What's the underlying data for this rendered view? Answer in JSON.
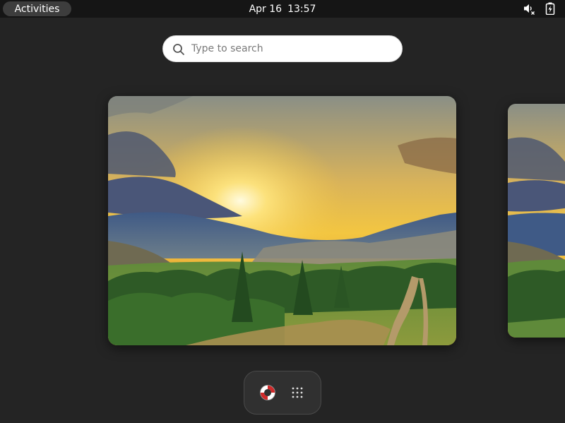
{
  "topbar": {
    "activities_label": "Activities",
    "date": "Apr 16",
    "time": "13:57",
    "icons": [
      "speaker-muted-icon",
      "battery-charging-icon"
    ]
  },
  "search": {
    "placeholder": "Type to search",
    "icon": "search-icon"
  },
  "workspaces": [
    {
      "name": "workspace-1",
      "wallpaper": "sunset-valley-landscape"
    },
    {
      "name": "workspace-2",
      "wallpaper": "sunset-valley-landscape"
    }
  ],
  "dash": {
    "items": [
      {
        "icon": "help-lifebuoy-icon"
      },
      {
        "icon": "app-grid-icon"
      }
    ]
  },
  "colors": {
    "background": "#242424",
    "topbar": "#151515",
    "activities_pill": "#3d3d3d",
    "dash_bg": "#303030"
  }
}
